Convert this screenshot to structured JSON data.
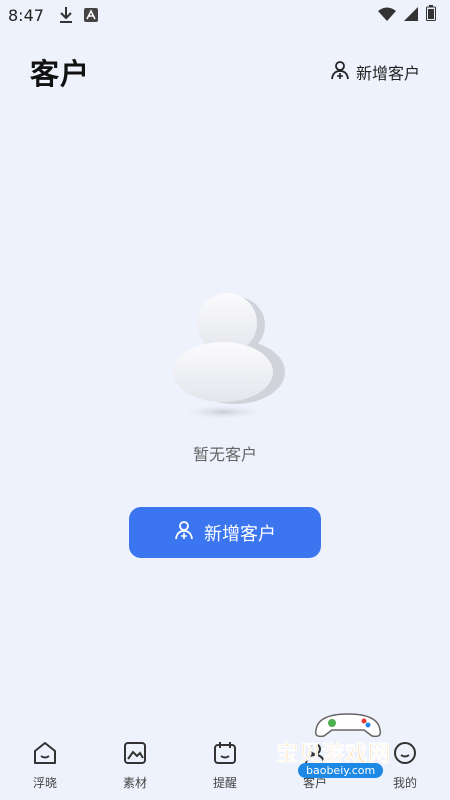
{
  "status_bar": {
    "time": "8:47"
  },
  "header": {
    "title": "客户",
    "add_label": "新增客户"
  },
  "empty_state": {
    "message": "暂无客户",
    "button_label": "新增客户"
  },
  "bottom_nav": {
    "items": [
      {
        "label": "浮晓",
        "icon": "home-icon"
      },
      {
        "label": "素材",
        "icon": "image-icon"
      },
      {
        "label": "提醒",
        "icon": "calendar-icon"
      },
      {
        "label": "客户",
        "icon": "user-icon"
      },
      {
        "label": "我的",
        "icon": "profile-icon"
      }
    ]
  },
  "watermark": {
    "text": "宝贝游戏网",
    "url": "baobeiy.com"
  },
  "colors": {
    "background": "#eef2fc",
    "accent": "#3b76f0"
  }
}
